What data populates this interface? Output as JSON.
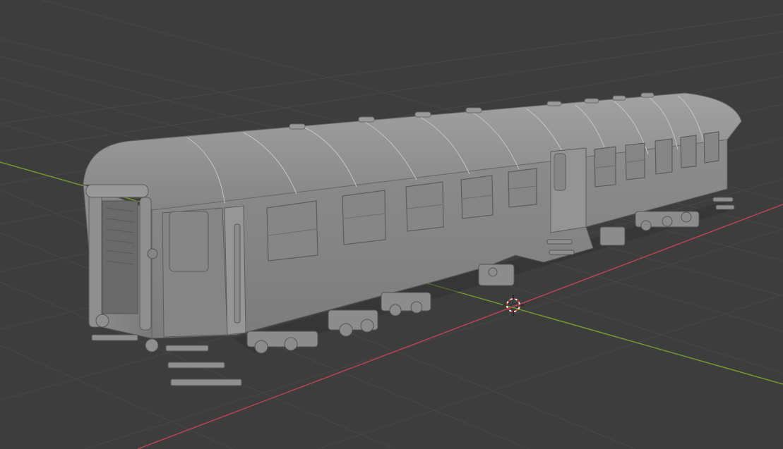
{
  "viewport": {
    "background": "#3d3d3d",
    "grid_color": "#4a4a4a",
    "x_axis_color": "#b8434e",
    "y_axis_color": "#6e9a2f",
    "cursor_color": "#d63a3a"
  },
  "model": {
    "body_color": "#8a8a8a",
    "shade_color": "#6f6f6f",
    "light_color": "#a3a3a3"
  }
}
